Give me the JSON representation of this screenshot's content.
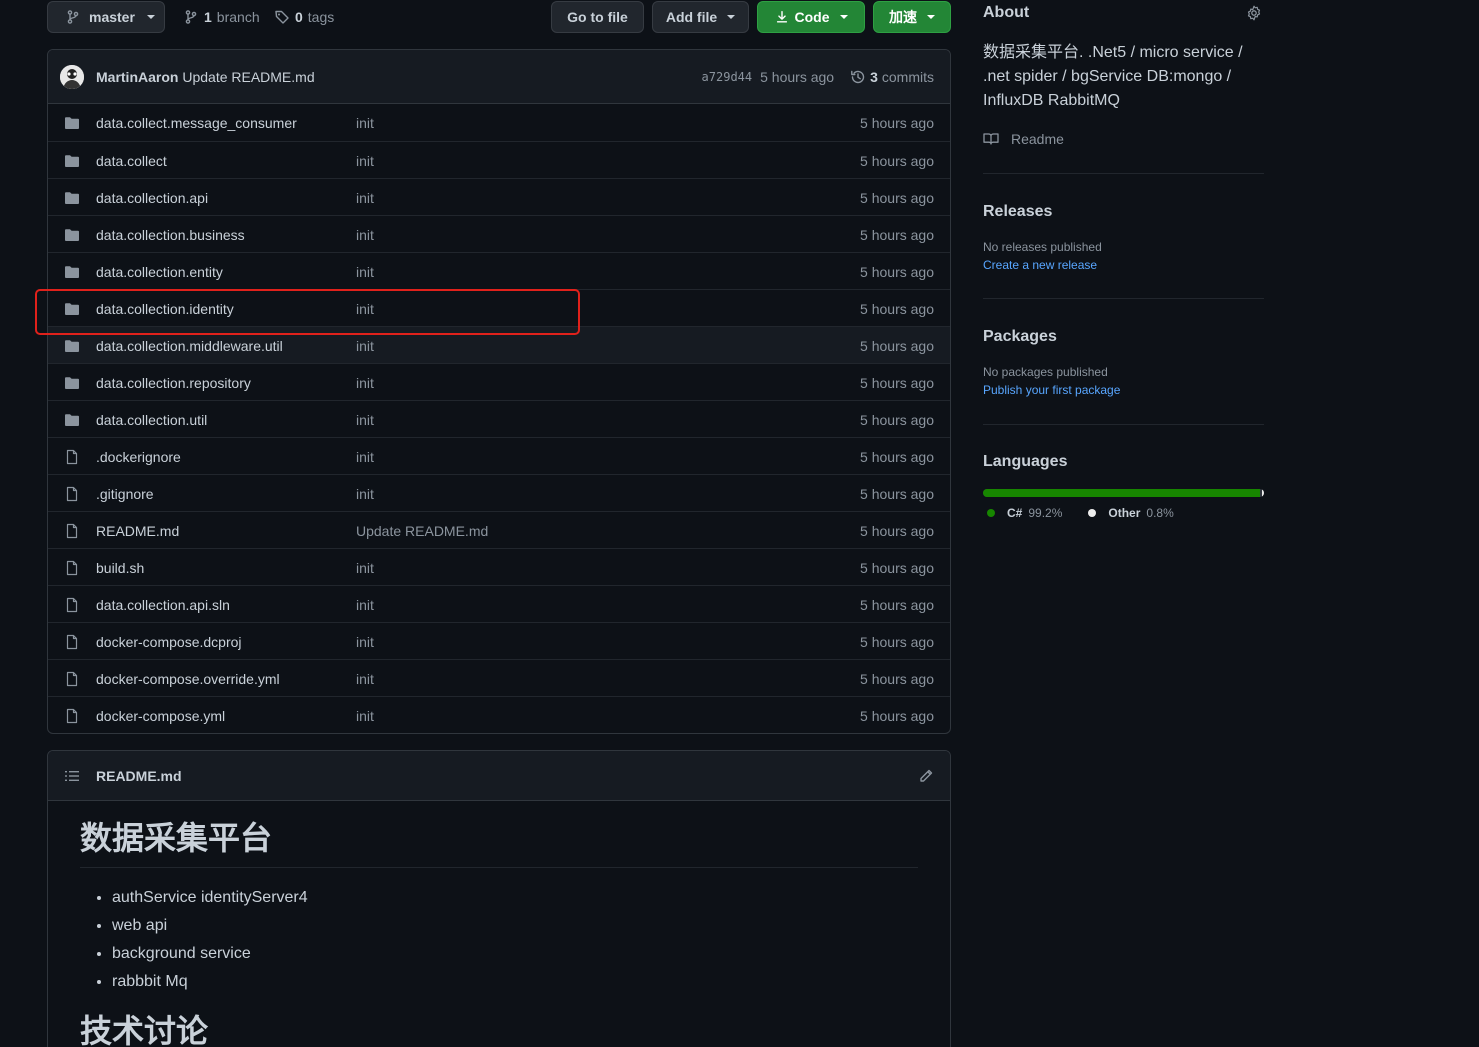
{
  "toolbar": {
    "branch_name": "master",
    "branch_count": "1",
    "branch_label": "branch",
    "tag_count": "0",
    "tag_label": "tags",
    "go_to_file": "Go to file",
    "add_file": "Add file",
    "code": "Code",
    "jiasu": "加速"
  },
  "commit": {
    "author": "MartinAaron",
    "message": "Update README.md",
    "sha": "a729d44",
    "time": "5 hours ago",
    "commit_count": "3",
    "commit_label": "commits"
  },
  "files": [
    {
      "name": "data.collect.message_consumer",
      "type": "folder",
      "message": "init",
      "age": "5 hours ago"
    },
    {
      "name": "data.collect",
      "type": "folder",
      "message": "init",
      "age": "5 hours ago"
    },
    {
      "name": "data.collection.api",
      "type": "folder",
      "message": "init",
      "age": "5 hours ago"
    },
    {
      "name": "data.collection.business",
      "type": "folder",
      "message": "init",
      "age": "5 hours ago"
    },
    {
      "name": "data.collection.entity",
      "type": "folder",
      "message": "init",
      "age": "5 hours ago"
    },
    {
      "name": "data.collection.identity",
      "type": "folder",
      "message": "init",
      "age": "5 hours ago"
    },
    {
      "name": "data.collection.middleware.util",
      "type": "folder",
      "message": "init",
      "age": "5 hours ago"
    },
    {
      "name": "data.collection.repository",
      "type": "folder",
      "message": "init",
      "age": "5 hours ago"
    },
    {
      "name": "data.collection.util",
      "type": "folder",
      "message": "init",
      "age": "5 hours ago"
    },
    {
      "name": ".dockerignore",
      "type": "file",
      "message": "init",
      "age": "5 hours ago"
    },
    {
      "name": ".gitignore",
      "type": "file",
      "message": "init",
      "age": "5 hours ago"
    },
    {
      "name": "README.md",
      "type": "file",
      "message": "Update README.md",
      "age": "5 hours ago"
    },
    {
      "name": "build.sh",
      "type": "file",
      "message": "init",
      "age": "5 hours ago"
    },
    {
      "name": "data.collection.api.sln",
      "type": "file",
      "message": "init",
      "age": "5 hours ago"
    },
    {
      "name": "docker-compose.dcproj",
      "type": "file",
      "message": "init",
      "age": "5 hours ago"
    },
    {
      "name": "docker-compose.override.yml",
      "type": "file",
      "message": "init",
      "age": "5 hours ago"
    },
    {
      "name": "docker-compose.yml",
      "type": "file",
      "message": "init",
      "age": "5 hours ago"
    }
  ],
  "readme": {
    "filename": "README.md",
    "heading": "数据采集平台",
    "items": [
      "authService identityServer4",
      "web api",
      "background service",
      "rabbbit Mq"
    ],
    "heading2": "技术讨论"
  },
  "about": {
    "title": "About",
    "description": "数据采集平台. .Net5 / micro service / .net spider / bgService DB:mongo / InfluxDB RabbitMQ",
    "readme_label": "Readme"
  },
  "releases": {
    "title": "Releases",
    "note": "No releases published",
    "link": "Create a new release"
  },
  "packages": {
    "title": "Packages",
    "note": "No packages published",
    "link": "Publish your first package"
  },
  "languages": {
    "title": "Languages",
    "items": [
      {
        "name": "C#",
        "percent": "99.2%",
        "value": 99.2,
        "color": "#178600"
      },
      {
        "name": "Other",
        "percent": "0.8%",
        "value": 0.8,
        "color": "#ededed"
      }
    ]
  },
  "colors": {
    "folder": "#8b949e",
    "accent_green": "#238636",
    "link": "#58a6ff",
    "highlight_box": "#e0211b"
  }
}
